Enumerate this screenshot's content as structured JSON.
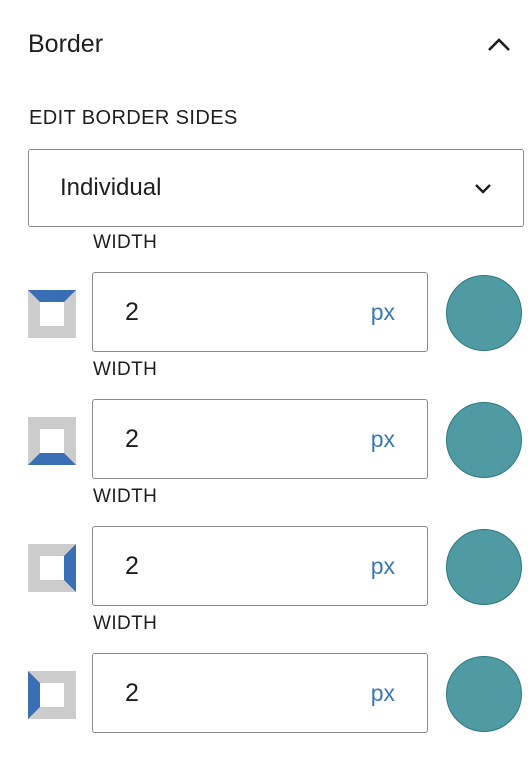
{
  "panel": {
    "title": "Border",
    "collapse_icon": "chevron-up-icon"
  },
  "edit_sides": {
    "label": "EDIT BORDER SIDES",
    "selected": "Individual",
    "dropdown_icon": "chevron-down-icon"
  },
  "sides": [
    {
      "side": "top",
      "label": "WIDTH",
      "value": "2",
      "unit": "px",
      "color": "#4f9aa3",
      "icon": "border-top-icon"
    },
    {
      "side": "bottom",
      "label": "WIDTH",
      "value": "2",
      "unit": "px",
      "color": "#4f9aa3",
      "icon": "border-bottom-icon"
    },
    {
      "side": "right",
      "label": "WIDTH",
      "value": "2",
      "unit": "px",
      "color": "#4f9aa3",
      "icon": "border-right-icon"
    },
    {
      "side": "left",
      "label": "WIDTH",
      "value": "2",
      "unit": "px",
      "color": "#4f9aa3",
      "icon": "border-left-icon"
    }
  ],
  "colors": {
    "accent": "#3a78b9",
    "side_highlight": "#3a6fb5",
    "side_base": "#cccccc"
  }
}
